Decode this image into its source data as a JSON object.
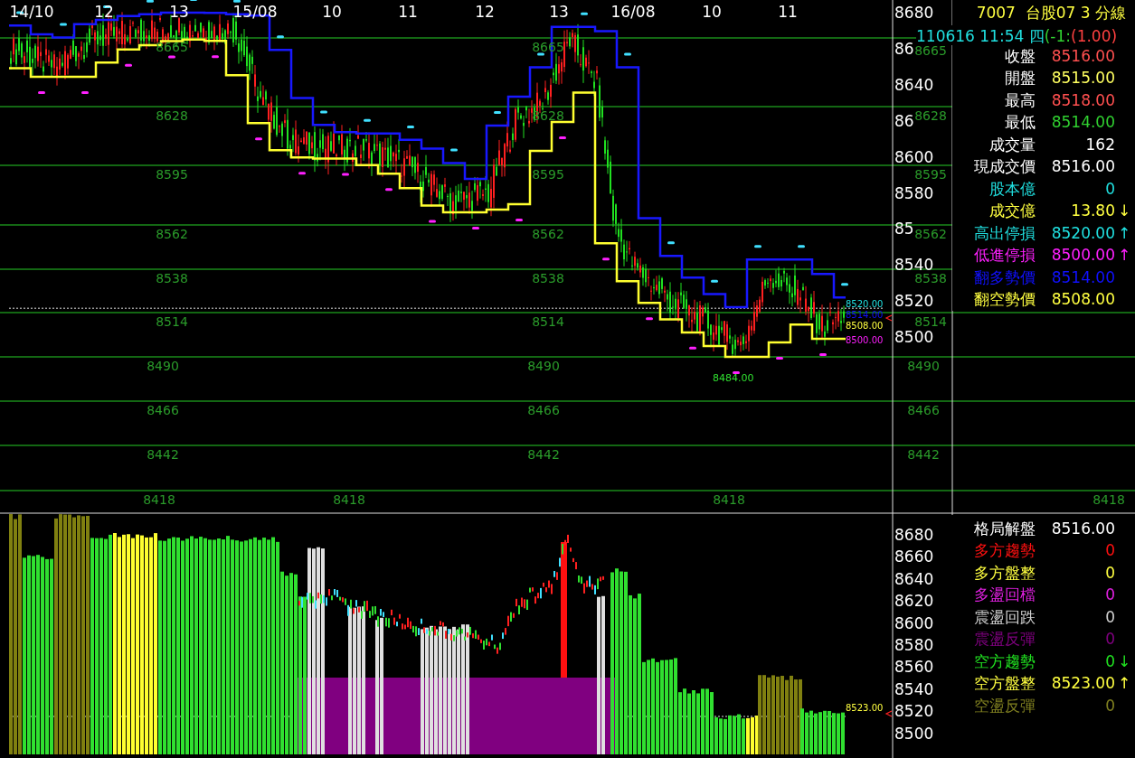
{
  "header": {
    "title": "7007  台股07 3 分線",
    "date": "110616 11:54 四",
    "change": "(-1:",
    "change_pct": "(1.00)"
  },
  "quote_rows": [
    {
      "label": {
        "text": "收盤",
        "color": "#ffffff"
      },
      "value": {
        "text": "8516.00",
        "color": "#ff5050"
      }
    },
    {
      "label": {
        "text": "開盤",
        "color": "#ffffff"
      },
      "value": {
        "text": "8515.00",
        "color": "#ffff60"
      }
    },
    {
      "label": {
        "text": "最高",
        "color": "#ffffff"
      },
      "value": {
        "text": "8518.00",
        "color": "#ff5050"
      }
    },
    {
      "label": {
        "text": "最低",
        "color": "#ffffff"
      },
      "value": {
        "text": "8514.00",
        "color": "#30d030"
      }
    },
    {
      "label": {
        "text": "成交量",
        "color": "#ffffff"
      },
      "value": {
        "text": "162",
        "color": "#ffffff"
      }
    },
    {
      "label": {
        "text": "現成交價",
        "color": "#ffffff"
      },
      "value": {
        "text": "8516.00",
        "color": "#ffffff"
      }
    },
    {
      "label": {
        "text": "股本億",
        "color": "#20e0e0"
      },
      "value": {
        "text": "0",
        "color": "#20e0e0"
      }
    },
    {
      "label": {
        "text": "成交億",
        "color": "#ffff40"
      },
      "value": {
        "text": "13.80",
        "color": "#ffff40"
      },
      "arrow": "↓"
    },
    {
      "label": {
        "text": "高出停損",
        "color": "#20e0e0"
      },
      "value": {
        "text": "8520.00",
        "color": "#20e0e0"
      },
      "arrow": "↑"
    },
    {
      "label": {
        "text": "低進停損",
        "color": "#ff20ff"
      },
      "value": {
        "text": "8500.00",
        "color": "#ff20ff"
      },
      "arrow": "↑"
    },
    {
      "label": {
        "text": "翻多勢價",
        "color": "#1010ff"
      },
      "value": {
        "text": "8514.00",
        "color": "#1010ff"
      }
    },
    {
      "label": {
        "text": "翻空勢價",
        "color": "#ffff40"
      },
      "value": {
        "text": "8508.00",
        "color": "#ffff40"
      }
    }
  ],
  "main_chart": {
    "time_labels": [
      "14/10",
      "12",
      "13",
      "15/08",
      "10",
      "11",
      "12",
      "13",
      "16/08",
      "10",
      "11"
    ],
    "price_axis": [
      "8680",
      "86",
      "8640",
      "86",
      "8600",
      "8580",
      "85",
      "8540",
      "8520",
      "8500"
    ],
    "grid_lines": [
      {
        "labels": [
          "8665",
          "8665",
          "8665"
        ]
      },
      {
        "labels": [
          "8628",
          "8628",
          "8628"
        ]
      },
      {
        "labels": [
          "8595",
          "8595",
          "8595"
        ]
      },
      {
        "labels": [
          "8562",
          "8562",
          "8562"
        ]
      },
      {
        "labels": [
          "8538",
          "8538",
          "8538"
        ]
      },
      {
        "labels": [
          "8514",
          "8514",
          "8514"
        ]
      },
      {
        "labels": [
          "8490",
          "8490",
          "8490"
        ]
      },
      {
        "labels": [
          "8466",
          "8466",
          "8466"
        ]
      },
      {
        "labels": [
          "8442",
          "8442",
          "8442"
        ]
      },
      {
        "labels": [
          "8418",
          "8418",
          "8418",
          "8418"
        ]
      }
    ],
    "price_tags": [
      {
        "text": "8520.00",
        "color": "#20e0e0"
      },
      {
        "text": "8514.00",
        "color": "#1010ff"
      },
      {
        "text": "8508.00",
        "color": "#ffff40"
      },
      {
        "text": "8500.00",
        "color": "#ff20ff"
      }
    ],
    "low_tag": "8484.00"
  },
  "sub_chart": {
    "price_axis": [
      "8680",
      "8660",
      "8640",
      "8620",
      "8600",
      "8580",
      "8560",
      "8540",
      "8520",
      "8500"
    ],
    "price_tags": [
      {
        "text": "8523.00",
        "color": "#ffff40"
      }
    ]
  },
  "signal_rows": [
    {
      "label": {
        "text": "格局解盤",
        "color": "#ffffff"
      },
      "value": {
        "text": "8516.00",
        "color": "#ffffff"
      }
    },
    {
      "label": {
        "text": "多方趨勢",
        "color": "#ff1010"
      },
      "value": {
        "text": "0",
        "color": "#ff1010"
      }
    },
    {
      "label": {
        "text": "多方盤整",
        "color": "#ffff40"
      },
      "value": {
        "text": "0",
        "color": "#ffff40"
      }
    },
    {
      "label": {
        "text": "多盪回檔",
        "color": "#e020e0"
      },
      "value": {
        "text": "0",
        "color": "#e020e0"
      }
    },
    {
      "label": {
        "text": "震盪回跌",
        "color": "#d0d0d0"
      },
      "value": {
        "text": "0",
        "color": "#d0d0d0"
      }
    },
    {
      "label": {
        "text": "震盪反彈",
        "color": "#800080"
      },
      "value": {
        "text": "0",
        "color": "#800080"
      }
    },
    {
      "label": {
        "text": "空方趨勢",
        "color": "#20e020"
      },
      "value": {
        "text": "0",
        "color": "#20e020"
      },
      "arrow": "↓"
    },
    {
      "label": {
        "text": "空方盤整",
        "color": "#ffff40"
      },
      "value": {
        "text": "8523.00",
        "color": "#ffff40"
      },
      "arrow": "↑"
    },
    {
      "label": {
        "text": "空盪反彈",
        "color": "#808020"
      },
      "value": {
        "text": "0",
        "color": "#808020"
      }
    }
  ]
}
